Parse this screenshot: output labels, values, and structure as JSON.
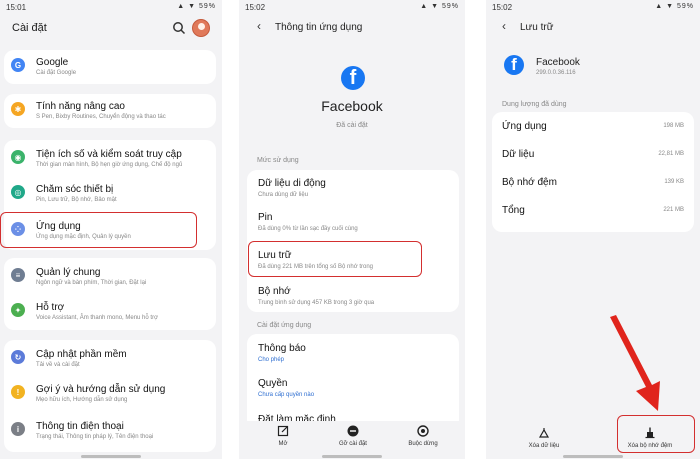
{
  "panel1": {
    "status_time": "15:01",
    "status_icons": "▲ ▼ 59%",
    "title": "Cài đặt",
    "items": [
      {
        "title": "Google",
        "subtitle": "Cài đặt Google",
        "icon": "google-icon",
        "color": "#4285f4"
      },
      {
        "title": "Tính năng nâng cao",
        "subtitle": "S Pen, Bixby Routines, Chuyển động và thao tác",
        "icon": "gear-plus-icon",
        "color": "#f5a623"
      },
      {
        "title": "Tiện ích số và kiểm soát truy cập",
        "subtitle": "Thời gian màn hình, Bộ hẹn giờ ứng dụng, Chế độ ngủ",
        "icon": "wellbeing-icon",
        "color": "#3bb36b"
      },
      {
        "title": "Chăm sóc thiết bị",
        "subtitle": "Pin, Lưu trữ, Bộ nhớ, Bảo mật",
        "icon": "device-care-icon",
        "color": "#20a889"
      },
      {
        "title": "Ứng dụng",
        "subtitle": "Ứng dụng mặc định, Quản lý quyền",
        "icon": "apps-icon",
        "color": "#6b8fe6"
      },
      {
        "title": "Quản lý chung",
        "subtitle": "Ngôn ngữ và bàn phím, Thời gian, Đặt lại",
        "icon": "sliders-icon",
        "color": "#6f7d92"
      },
      {
        "title": "Hỗ trợ",
        "subtitle": "Voice Assistant, Âm thanh mono, Menu hỗ trợ",
        "icon": "accessibility-icon",
        "color": "#4caf50"
      },
      {
        "title": "Cập nhật phần mềm",
        "subtitle": "Tải về và cài đặt",
        "icon": "update-icon",
        "color": "#5c7bd9"
      },
      {
        "title": "Gợi ý và hướng dẫn sử dụng",
        "subtitle": "Mẹo hữu ích, Hướng dẫn sử dụng",
        "icon": "tips-icon",
        "color": "#f2b321"
      },
      {
        "title": "Thông tin điện thoại",
        "subtitle": "Trạng thái, Thông tin pháp lý, Tên điện thoại",
        "icon": "info-icon",
        "color": "#7b7f86"
      }
    ]
  },
  "panel2": {
    "status_time": "15:02",
    "status_icons": "▲ ▼ 59%",
    "title": "Thông tin ứng dụng",
    "app_name": "Facebook",
    "app_status": "Đã cài đặt",
    "section_usage": "Mức sử dụng",
    "rows": [
      {
        "title": "Dữ liệu di động",
        "subtitle": "Chưa dùng dữ liệu"
      },
      {
        "title": "Pin",
        "subtitle": "Đã dùng 0% từ lần sạc đầy cuối cùng"
      },
      {
        "title": "Lưu trữ",
        "subtitle": "Đã dùng 221 MB trên tổng số Bộ nhớ trong"
      },
      {
        "title": "Bộ nhớ",
        "subtitle": "Trung bình sử dụng 457 KB trong 3 giờ qua"
      }
    ],
    "section_settings": "Cài đặt ứng dụng",
    "settings_rows": [
      {
        "title": "Thông báo",
        "subtitle": "Cho phép"
      },
      {
        "title": "Quyền",
        "subtitle": "Chưa cấp quyền nào"
      },
      {
        "title": "Đặt làm mặc định",
        "subtitle": ""
      }
    ],
    "bottom": [
      {
        "label": "Mở",
        "icon": "open-icon"
      },
      {
        "label": "Gỡ cài đặt",
        "icon": "uninstall-icon"
      },
      {
        "label": "Buộc dừng",
        "icon": "force-stop-icon"
      }
    ]
  },
  "panel3": {
    "status_time": "15:02",
    "status_icons": "▲ ▼ 59%",
    "title": "Lưu trữ",
    "app_name": "Facebook",
    "app_version": "299.0.0.36.116",
    "section_label": "Dung lượng đã dùng",
    "rows": [
      {
        "label": "Ứng dụng",
        "value": "198 MB"
      },
      {
        "label": "Dữ liệu",
        "value": "22,81 MB"
      },
      {
        "label": "Bộ nhớ đệm",
        "value": "139 KB"
      },
      {
        "label": "Tổng",
        "value": "221 MB"
      }
    ],
    "bottom": [
      {
        "label": "Xóa dữ liệu",
        "icon": "clear-data-icon"
      },
      {
        "label": "Xóa bộ nhớ đệm",
        "icon": "clear-cache-icon"
      }
    ]
  },
  "colors": {
    "highlight": "#d32f2f",
    "facebook": "#1877f2",
    "arrow": "#e0241c"
  }
}
